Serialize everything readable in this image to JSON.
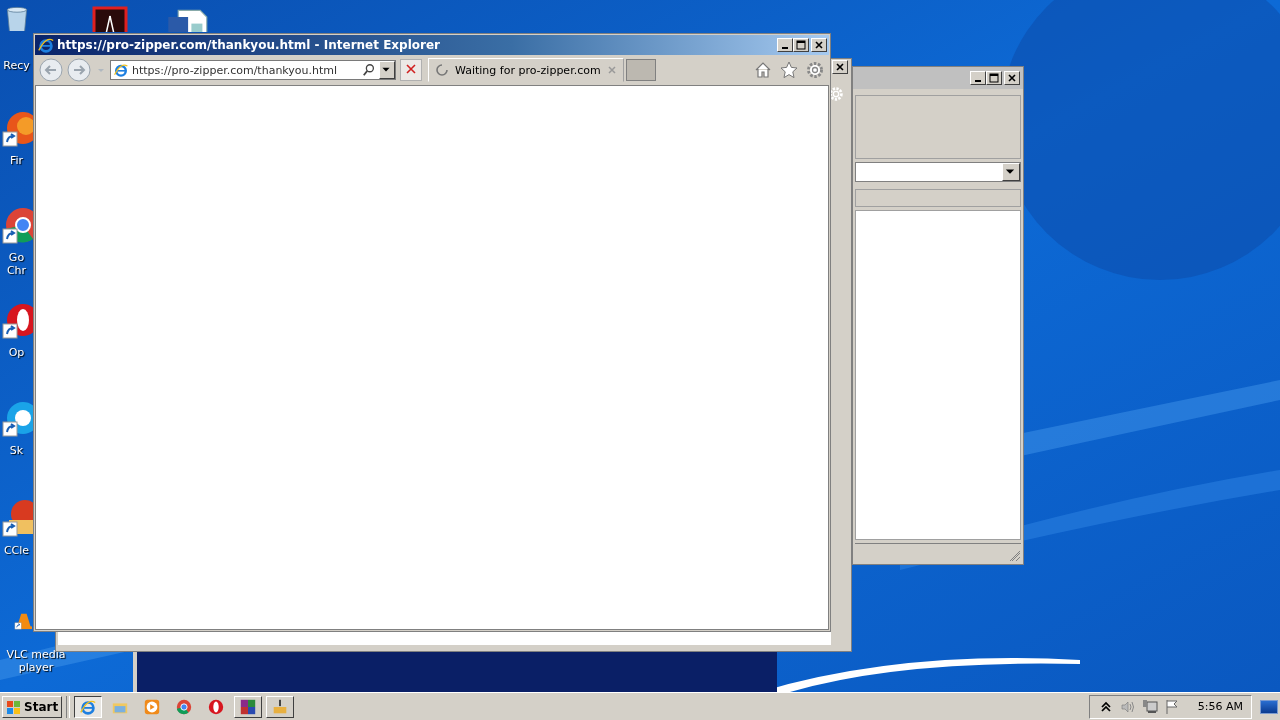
{
  "desktop_icons": [
    {
      "kind": "recycle-bin",
      "label": "Recy"
    },
    {
      "kind": "pdf"
    },
    {
      "kind": "word"
    },
    {
      "kind": "firefox",
      "label": "Fir"
    },
    {
      "kind": "chrome",
      "label": "Go Chr"
    },
    {
      "kind": "opera",
      "label": "Op"
    },
    {
      "kind": "skype",
      "label": "Sk"
    },
    {
      "kind": "ccleaner",
      "label": "CCle"
    },
    {
      "kind": "vlc",
      "label": "VLC media player"
    }
  ],
  "browser_window": {
    "title": "https://pro-zipper.com/thankyou.html - Internet Explorer",
    "address": "https://pro-zipper.com/thankyou.html",
    "tabs": [
      {
        "label": "Waiting for pro-zipper.com",
        "selected": true,
        "loading": true
      }
    ]
  },
  "taskbar": {
    "start": "Start",
    "items": [
      {
        "kind": "ie",
        "selected": true,
        "running": true
      },
      {
        "kind": "folder",
        "selected": false,
        "running": false
      },
      {
        "kind": "media",
        "selected": false,
        "running": false
      },
      {
        "kind": "chrome",
        "selected": false,
        "running": false
      },
      {
        "kind": "opera",
        "selected": false,
        "running": false
      },
      {
        "kind": "winrar",
        "selected": false,
        "running": true
      },
      {
        "kind": "app",
        "selected": false,
        "running": true
      }
    ],
    "clock": "5:56 AM"
  }
}
